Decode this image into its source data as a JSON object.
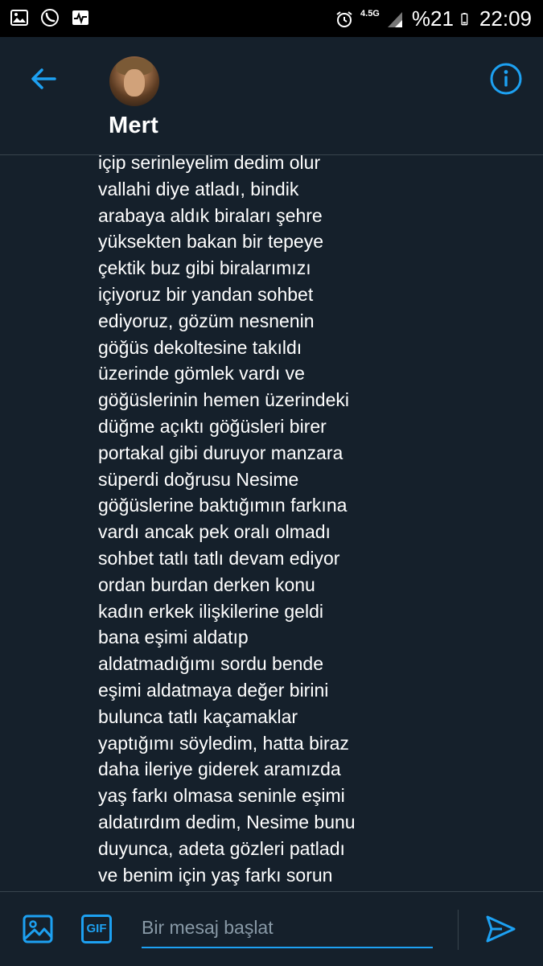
{
  "status_bar": {
    "network": "4.5G",
    "battery": "%21",
    "time": "22:09"
  },
  "header": {
    "contact_name": "Mert"
  },
  "message": {
    "lines": [
      "içip serinleyelim dedim olur",
      "vallahi diye atladı, bindik",
      "arabaya aldık biraları şehre",
      "yüksekten bakan bir tepeye",
      "çektik buz gibi biralarımızı",
      "içiyoruz bir yandan sohbet",
      "ediyoruz, gözüm nesnenin",
      "göğüs dekoltesine takıldı",
      "üzerinde gömlek vardı ve",
      "göğüslerinin hemen üzerindeki",
      "düğme açıktı göğüsleri birer",
      "portakal gibi duruyor manzara",
      "süperdi doğrusu Nesime",
      "göğüslerine baktığımın farkına",
      "vardı ancak pek oralı olmadı",
      "sohbet tatlı tatlı devam ediyor",
      "ordan burdan derken konu",
      "kadın erkek ilişkilerine geldi",
      "bana eşimi aldatıp",
      "aldatmadığımı sordu bende",
      "eşimi aldatmaya değer birini",
      "bulunca tatlı kaçamaklar",
      "yaptığımı söyledim, hatta biraz",
      "daha ileriye giderek aramızda",
      "yaş farkı olmasa seninle eşimi",
      "aldatırdım dedim, Nesime bunu",
      "duyunca, adeta gözleri patladı",
      "ve benim için yaş farkı sorun"
    ]
  },
  "composer": {
    "gif_label": "GIF",
    "placeholder": "Bir mesaj başlat"
  },
  "colors": {
    "background": "#15202b",
    "accent": "#1da1f2",
    "divider": "#38444d",
    "muted": "#8899a6"
  },
  "icons": {
    "back": "arrow-left-icon",
    "info": "info-icon",
    "media": "image-icon",
    "gif": "gif-icon",
    "send": "send-icon"
  }
}
